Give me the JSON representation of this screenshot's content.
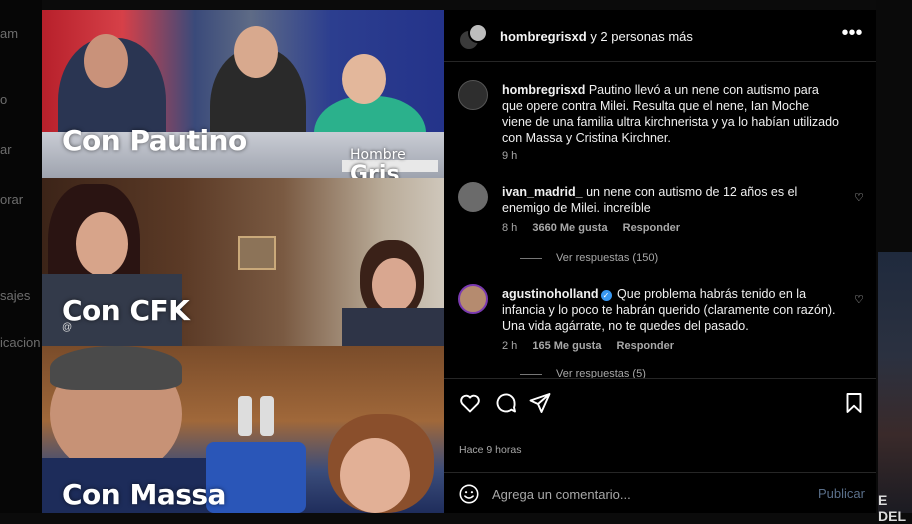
{
  "background": {
    "sidebar_fragments": [
      "am",
      "o",
      "ar",
      "orar",
      "sajes",
      "icacion"
    ],
    "right_fragment": "E DEL"
  },
  "media": {
    "labels": [
      "Con Pautino",
      "Con CFK",
      "Con Massa"
    ],
    "watermark_line1": "Hombre",
    "watermark_line2": "Gris",
    "small_mark": "@"
  },
  "header": {
    "username": "hombregrisxd",
    "suffix": "y 2 personas más",
    "more_icon": "more-horizontal-icon"
  },
  "caption": {
    "username": "hombregrisxd",
    "text": "Pautino llevó a un nene con autismo para que opere contra Milei. Resulta que el nene, Ian Moche viene de una familia ultra kirchnerista y ya lo habían utilizado con Massa y Cristina Kirchner.",
    "time": "9 h"
  },
  "comments": [
    {
      "username": "ivan_madrid_",
      "text": "un nene con autismo de 12 años es el enemigo de Milei. increíble",
      "time": "8 h",
      "likes": "3660 Me gusta",
      "reply": "Responder",
      "view_replies": "Ver respuestas (150)"
    },
    {
      "username": "agustinoholland",
      "verified": true,
      "text": "Que problema habrás tenido en la infancia y lo poco te habrán querido (claramente con razón). Una vida agárrate, no te quedes del pasado.",
      "time": "2 h",
      "likes": "165 Me gusta",
      "reply": "Responder",
      "view_replies": "Ver respuestas (5)"
    }
  ],
  "actions": {
    "like_icon": "heart-icon",
    "comment_icon": "comment-icon",
    "share_icon": "send-icon",
    "save_icon": "bookmark-icon",
    "time_ago": "Hace 9 horas"
  },
  "composer": {
    "placeholder": "Agrega un comentario...",
    "publish": "Publicar",
    "emoji_icon": "emoji-icon"
  },
  "colors": {
    "verified": "#3897f0",
    "publish_disabled": "#5a6f8a",
    "panel_bg": "#000000",
    "secondary_text": "#a8a8a8"
  }
}
